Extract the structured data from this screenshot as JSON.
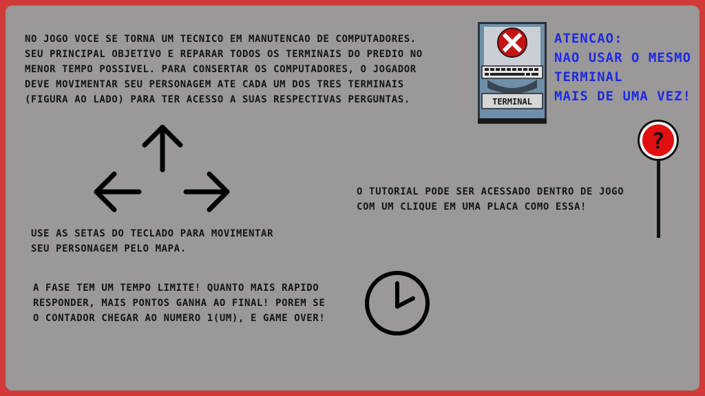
{
  "intro": {
    "lines": [
      "No jogo voce se torna um tecnico em manutencao de computadores.",
      "Seu principal objetivo e reparar todos os terminais do predio no",
      "menor tempo possivel. Para consertar os computadores, o jogador",
      "deve movimentar seu personagem ate cada um dos tres terminais",
      "(figura ao lado) para ter acesso a suas respectivas perguntas."
    ]
  },
  "terminal": {
    "label": "TERMINAL"
  },
  "warning": {
    "lines": [
      "ATENCAO:",
      "NAO USAR O MESMO",
      "TERMINAL",
      "MAIS DE UMA VEZ!"
    ],
    "color": "#1f2ae0"
  },
  "arrows_text": {
    "lines": [
      "Use as setas do teclado para movimentar",
      "seu personagem pelo mapa."
    ]
  },
  "tutorial_text": {
    "lines": [
      "O tutorial pode ser acessado dentro de jogo",
      "com um clique em uma placa como essa!"
    ]
  },
  "timer_text": {
    "lines": [
      "A fase tem um tempo limite! Quanto mais rapido",
      "responder, mais pontos ganha ao final! Porem se",
      "o contador chegar ao numero 1(um), e game over!"
    ]
  },
  "sign": {
    "symbol": "?"
  },
  "colors": {
    "background_frame": "#d23a3a",
    "panel": "#9a9898",
    "sign_red": "#e01010"
  }
}
